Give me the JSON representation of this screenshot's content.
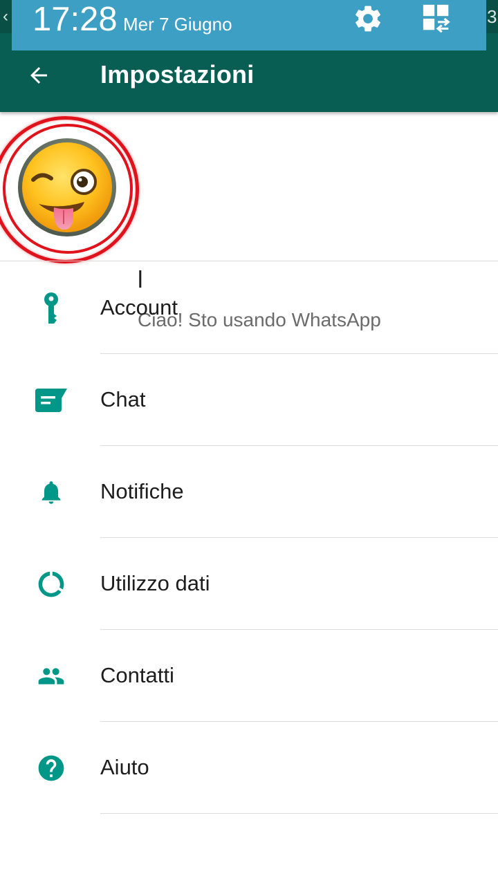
{
  "status_bar": {
    "time": "17:28",
    "date": "Mer 7 Giugno",
    "quick_icons": [
      "gear-icon",
      "quick-settings-icon"
    ]
  },
  "app_bar": {
    "title": "Impostazioni",
    "back_icon": "arrow-back-icon"
  },
  "profile": {
    "name": "l",
    "status": "Ciao! Sto usando WhatsApp",
    "avatar": "winking-tongue-emoji"
  },
  "menu": {
    "items": [
      {
        "label": "Account",
        "icon": "key-icon"
      },
      {
        "label": "Chat",
        "icon": "chat-icon"
      },
      {
        "label": "Notifiche",
        "icon": "bell-icon"
      },
      {
        "label": "Utilizzo dati",
        "icon": "data-usage-icon"
      },
      {
        "label": "Contatti",
        "icon": "contacts-icon"
      },
      {
        "label": "Aiuto",
        "icon": "help-icon"
      }
    ]
  },
  "colors": {
    "app_bar": "#085e53",
    "status_bar": "#0a4f45",
    "notification_panel": "#3d9fc4",
    "accent": "#009688",
    "highlight": "#e0121b"
  }
}
